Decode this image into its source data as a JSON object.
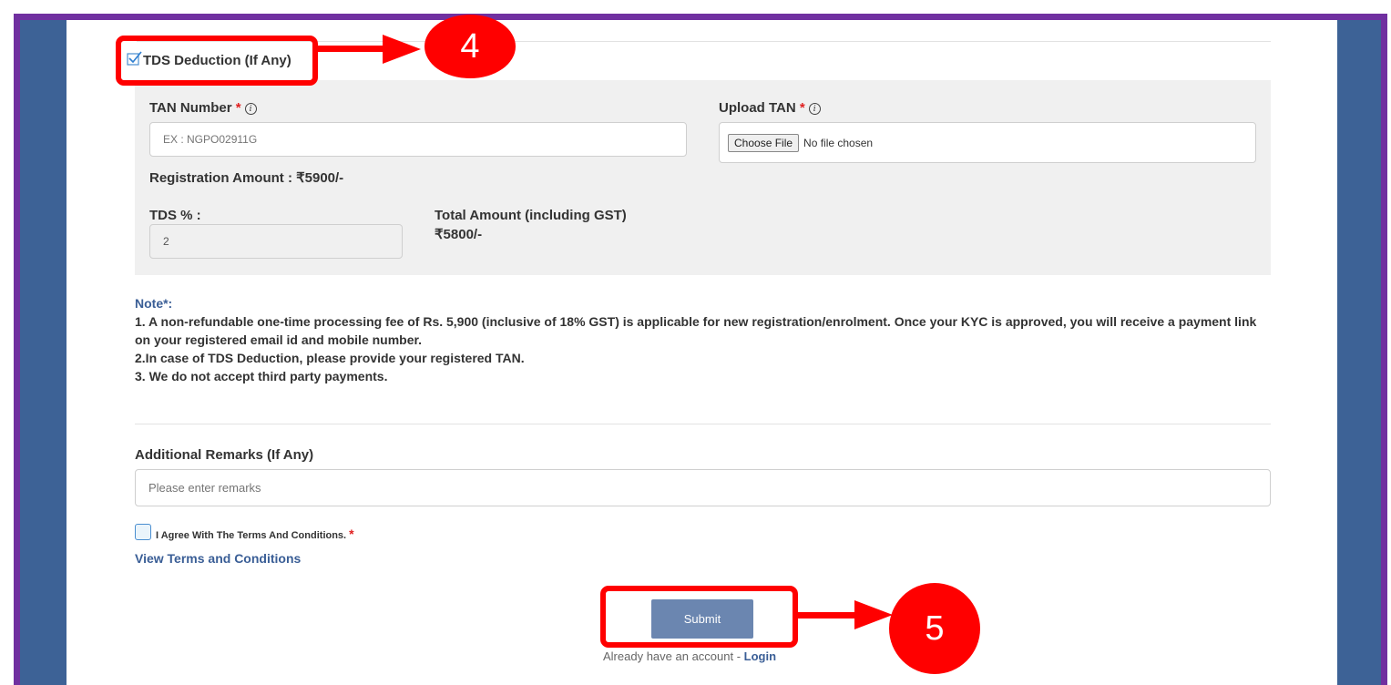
{
  "tds": {
    "label": "TDS Deduction (If Any)",
    "checked": true
  },
  "tan_number": {
    "label": "TAN Number",
    "required_mark": "*",
    "placeholder": "EX : NGPO02911G"
  },
  "upload_tan": {
    "label": "Upload TAN",
    "required_mark": "*",
    "button": "Choose File",
    "status": "No file chosen"
  },
  "registration_amount": "Registration Amount : ₹5900/-",
  "tds_percent": {
    "label": "TDS % :",
    "value": "2"
  },
  "total_amount": {
    "label": "Total Amount (including GST)",
    "value": "₹5800/-"
  },
  "note": {
    "heading": "Note*:",
    "line1": "1. A non-refundable one-time processing fee of Rs. 5,900 (inclusive of 18% GST) is applicable for new registration/enrolment. Once your KYC is approved, you will receive a payment link on your registered email id and mobile number.",
    "line2": "2.In case of TDS Deduction, please provide your registered TAN.",
    "line3": "3. We do not accept third party payments."
  },
  "remarks": {
    "label": "Additional Remarks (If Any)",
    "placeholder": "Please enter remarks"
  },
  "agree": {
    "label": "I Agree With The Terms And Conditions.",
    "required_mark": "*"
  },
  "view_terms": "View Terms and Conditions",
  "submit_label": "Submit",
  "account": {
    "text": "Already have an account - ",
    "login": "Login"
  },
  "annotations": {
    "step4": "4",
    "step5": "5"
  },
  "colors": {
    "accent_blue": "#3d6296",
    "border_purple": "#7030a0",
    "highlight_red": "#ff0000",
    "submit_bg": "#6b86b0"
  }
}
